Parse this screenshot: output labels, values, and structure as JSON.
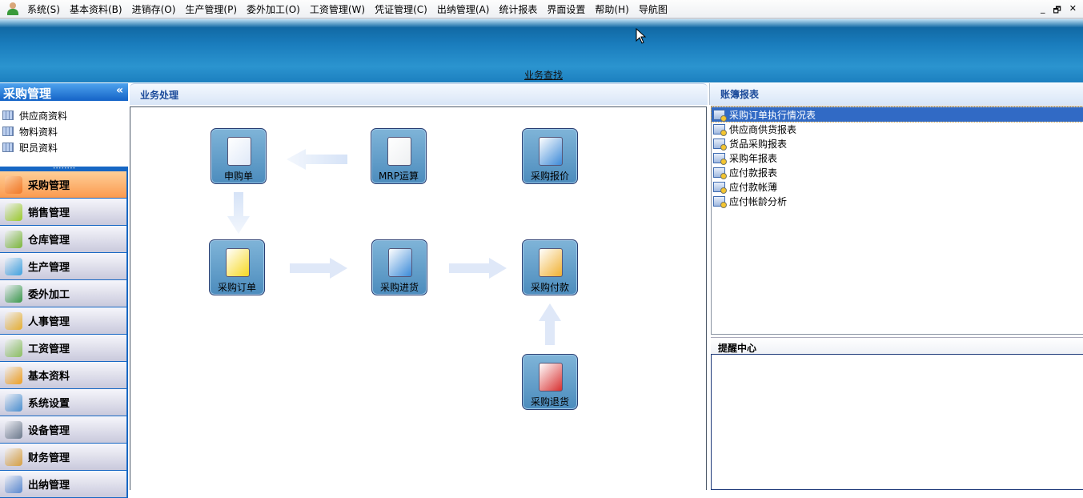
{
  "menu": {
    "items": [
      "系统(S)",
      "基本资料(B)",
      "进销存(O)",
      "生产管理(P)",
      "委外加工(O)",
      "工资管理(W)",
      "凭证管理(C)",
      "出纳管理(A)",
      "统计报表",
      "界面设置",
      "帮助(H)",
      "导航图"
    ],
    "window_controls": [
      "_",
      "🗗",
      "✕"
    ]
  },
  "banner": {
    "search_link": "业务查找"
  },
  "sidebar": {
    "title": "采购管理",
    "collapse": "«",
    "items": [
      "供应商资料",
      "物料资料",
      "职员资料"
    ],
    "splitter": "••••••••",
    "nav": [
      {
        "label": "采购管理",
        "color": "#f07a2a"
      },
      {
        "label": "销售管理",
        "color": "#9ccc2a"
      },
      {
        "label": "仓库管理",
        "color": "#7cb83a"
      },
      {
        "label": "生产管理",
        "color": "#3fa3e0"
      },
      {
        "label": "委外加工",
        "color": "#3a9a4a"
      },
      {
        "label": "人事管理",
        "color": "#e8b030"
      },
      {
        "label": "工资管理",
        "color": "#8cc060"
      },
      {
        "label": "基本资料",
        "color": "#f0a020"
      },
      {
        "label": "系统设置",
        "color": "#4a90d0"
      },
      {
        "label": "设备管理",
        "color": "#6c7a8c"
      },
      {
        "label": "财务管理",
        "color": "#d8a040"
      },
      {
        "label": "出纳管理",
        "color": "#5a8ad0"
      }
    ]
  },
  "main": {
    "title": "业务处理",
    "tiles": [
      {
        "label": "申购单",
        "icon": "requisition-icon",
        "color": "#dfe9f8"
      },
      {
        "label": "MRP运算",
        "icon": "mrp-calc-icon",
        "color": "#eef0f2"
      },
      {
        "label": "采购报价",
        "icon": "quote-notebook-icon",
        "color": "#3d8ad8"
      },
      {
        "label": "采购订单",
        "icon": "clipboard-icon",
        "color": "#f6d820"
      },
      {
        "label": "采购进货",
        "icon": "box-icon",
        "color": "#3a8ad8"
      },
      {
        "label": "采购付款",
        "icon": "coins-icon",
        "color": "#f0b030"
      },
      {
        "label": "采购退货",
        "icon": "return-box-icon",
        "color": "#d83030"
      }
    ]
  },
  "reports": {
    "title": "账簿报表",
    "items": [
      "采购订单执行情况表",
      "供应商供货报表",
      "货品采购报表",
      "采购年报表",
      "应付款报表",
      "应付款帐薄",
      "应付帐龄分析"
    ]
  },
  "reminder": {
    "title": "提醒中心"
  }
}
